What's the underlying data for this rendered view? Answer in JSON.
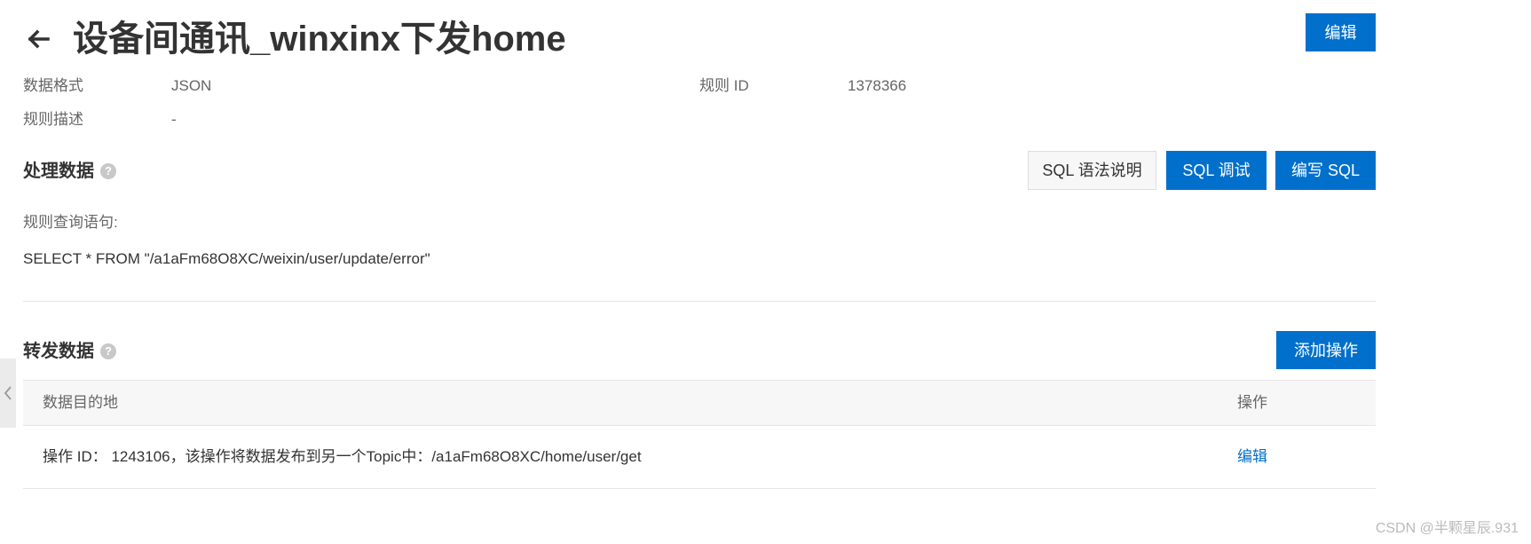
{
  "header": {
    "back_icon": "arrow-left-icon",
    "title": "设备间通讯_winxinx下发home",
    "edit_label": "编辑"
  },
  "meta": {
    "data_format_label": "数据格式",
    "data_format_value": "JSON",
    "rule_id_label": "规则 ID",
    "rule_id_value": "1378366",
    "rule_desc_label": "规则描述",
    "rule_desc_value": "-"
  },
  "process_section": {
    "title": "处理数据",
    "help_icon": "question-circle-icon",
    "sql_syntax_label": "SQL 语法说明",
    "sql_debug_label": "SQL 调试",
    "write_sql_label": "编写 SQL",
    "query_label": "规则查询语句:",
    "query_value": "SELECT * FROM \"/a1aFm68O8XC/weixin/user/update/error\""
  },
  "forward_section": {
    "title": "转发数据",
    "help_icon": "question-circle-icon",
    "add_action_label": "添加操作",
    "table": {
      "columns": [
        "数据目的地",
        "操作"
      ],
      "rows": [
        {
          "destination": "操作 ID： 1243106，该操作将数据发布到另一个Topic中：/a1aFm68O8XC/home/user/get",
          "action": "编辑"
        }
      ]
    }
  },
  "sidebar_toggle": {
    "icon": "chevron-left-icon"
  },
  "watermark": "CSDN @半颗星辰.931",
  "colors": {
    "primary": "#0070cc",
    "text": "#333333",
    "muted": "#666666",
    "border": "#e6e6e6"
  }
}
